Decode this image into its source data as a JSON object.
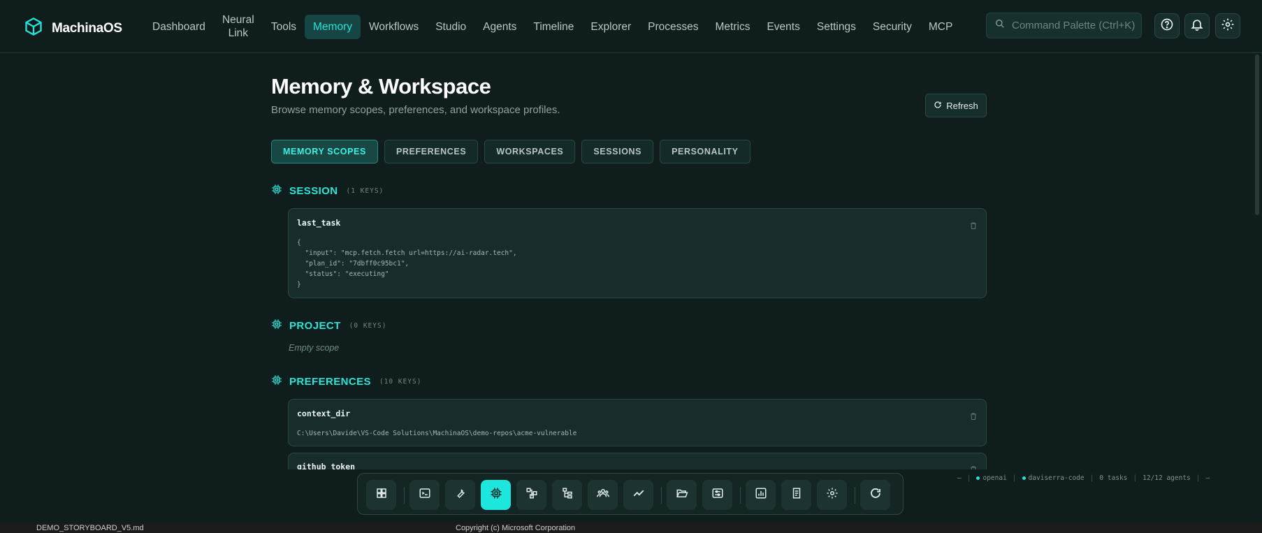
{
  "app": {
    "name": "MachinaOS"
  },
  "nav": {
    "items": [
      {
        "label": "Dashboard"
      },
      {
        "label": "Neural Link"
      },
      {
        "label": "Tools"
      },
      {
        "label": "Memory"
      },
      {
        "label": "Workflows"
      },
      {
        "label": "Studio"
      },
      {
        "label": "Agents"
      },
      {
        "label": "Timeline"
      },
      {
        "label": "Explorer"
      },
      {
        "label": "Processes"
      },
      {
        "label": "Metrics"
      },
      {
        "label": "Events"
      },
      {
        "label": "Settings"
      },
      {
        "label": "Security"
      },
      {
        "label": "MCP"
      }
    ],
    "active": "Memory",
    "search_placeholder": "Command Palette (Ctrl+K)"
  },
  "page": {
    "title": "Memory & Workspace",
    "subtitle": "Browse memory scopes, preferences, and workspace profiles.",
    "refresh_label": "Refresh"
  },
  "tabs": [
    {
      "label": "MEMORY SCOPES"
    },
    {
      "label": "PREFERENCES"
    },
    {
      "label": "WORKSPACES"
    },
    {
      "label": "SESSIONS"
    },
    {
      "label": "PERSONALITY"
    }
  ],
  "sections": {
    "session": {
      "title": "SESSION",
      "count": "(1 KEYS)",
      "entries": [
        {
          "key": "last_task",
          "value": "{\n  \"input\": \"mcp.fetch.fetch url=https://ai-radar.tech\",\n  \"plan_id\": \"7dbff0c95bc1\",\n  \"status\": \"executing\"\n}"
        }
      ]
    },
    "project": {
      "title": "PROJECT",
      "count": "(0 KEYS)",
      "empty_text": "Empty scope"
    },
    "preferences": {
      "title": "PREFERENCES",
      "count": "(10 KEYS)",
      "entries": [
        {
          "key": "context_dir",
          "value": "C:\\Users\\Davide\\VS-Code Solutions\\MachinaOS\\demo-repos\\acme-vulnerable"
        },
        {
          "key": "github_token",
          "value": ""
        }
      ]
    }
  },
  "status_bar": {
    "left_dash": "—",
    "provider": "openai",
    "user": "daviserra-code",
    "tasks": "0 tasks",
    "agents": "12/12 agents",
    "right_dash": "—"
  },
  "dock": {
    "items": [
      {
        "icon": "grid-icon"
      },
      {
        "icon": "terminal-icon"
      },
      {
        "icon": "wrench-icon"
      },
      {
        "icon": "chip-icon"
      },
      {
        "icon": "workflow-icon"
      },
      {
        "icon": "hierarchy-icon"
      },
      {
        "icon": "team-icon"
      },
      {
        "icon": "trend-icon"
      },
      {
        "icon": "folder-open-icon"
      },
      {
        "icon": "sliders-icon"
      },
      {
        "icon": "chart-icon"
      },
      {
        "icon": "document-icon"
      },
      {
        "icon": "gear-icon"
      },
      {
        "icon": "refresh-icon"
      }
    ],
    "active": "chip-icon"
  },
  "background": {
    "left_text": "DEMO_STORYBOARD_V5.md",
    "center_text": "Copyright (c) Microsoft Corporation"
  },
  "colors": {
    "accent": "#27e2d8",
    "background": "#0f1e1d",
    "card": "#182d2b"
  }
}
